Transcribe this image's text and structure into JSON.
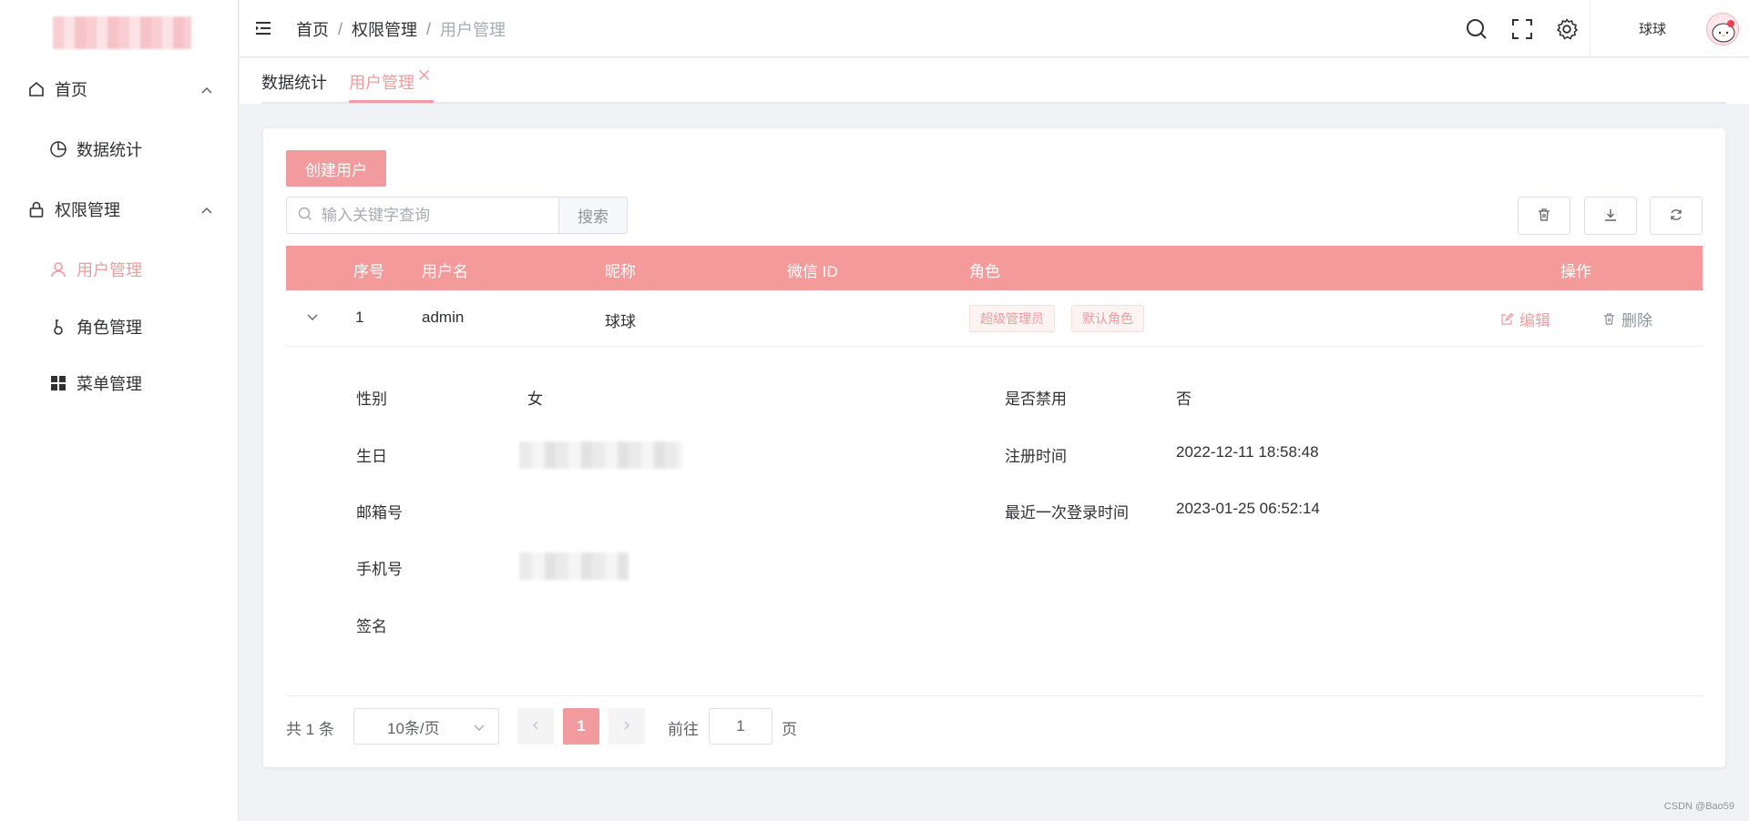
{
  "sidebar": {
    "items": [
      {
        "label": "首页",
        "icon": "home-icon",
        "expandable": true
      },
      {
        "label": "数据统计",
        "icon": "pie-chart-icon"
      },
      {
        "label": "权限管理",
        "icon": "lock-icon",
        "expandable": true
      },
      {
        "label": "用户管理",
        "icon": "user-icon",
        "active": true
      },
      {
        "label": "角色管理",
        "icon": "key-icon"
      },
      {
        "label": "菜单管理",
        "icon": "grid-icon"
      }
    ]
  },
  "header": {
    "breadcrumb": [
      "首页",
      "权限管理",
      "用户管理"
    ],
    "separator": "/",
    "username": "球球"
  },
  "tabs": [
    {
      "label": "数据统计"
    },
    {
      "label": "用户管理",
      "active": true,
      "closable": true
    }
  ],
  "toolbar": {
    "create_label": "创建用户",
    "search_placeholder": "输入关键字查询",
    "search_label": "搜索"
  },
  "table": {
    "columns": [
      "序号",
      "用户名",
      "昵称",
      "微信 ID",
      "角色",
      "操作"
    ],
    "rows": [
      {
        "index": "1",
        "username": "admin",
        "nickname": "球球",
        "wechat_id": "",
        "roles": [
          "超级管理员",
          "默认角色"
        ],
        "edit_label": "编辑",
        "delete_label": "删除"
      }
    ]
  },
  "detail": {
    "gender_label": "性别",
    "gender_value": "女",
    "birthday_label": "生日",
    "email_label": "邮箱号",
    "phone_label": "手机号",
    "signature_label": "签名",
    "disabled_label": "是否禁用",
    "disabled_value": "否",
    "register_label": "注册时间",
    "register_value": "2022-12-11 18:58:48",
    "lastlogin_label": "最近一次登录时间",
    "lastlogin_value": "2023-01-25 06:52:14"
  },
  "pagination": {
    "total_text": "共 1 条",
    "page_size": "10条/页",
    "current_page": "1",
    "goto_label": "前往",
    "goto_value": "1",
    "page_suffix": "页"
  },
  "watermark": "CSDN @Bao59",
  "colors": {
    "accent": "#f29b9e",
    "header_bg": "#f49a9b"
  }
}
